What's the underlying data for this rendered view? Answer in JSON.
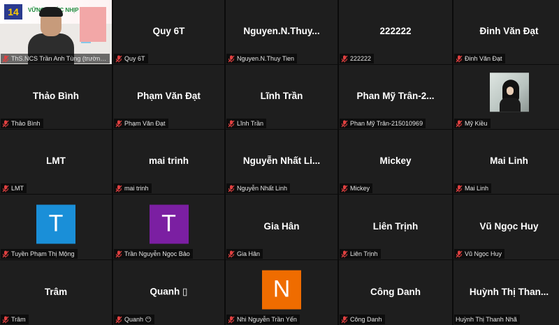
{
  "colors": {
    "tile_bg": "#1e1e1e",
    "speaker_border": "#c8e04a",
    "mute_icon": "#e04040",
    "avatar_t1": "#1a8fd8",
    "avatar_t2": "#7b1fa2",
    "avatar_n": "#ef6c00"
  },
  "speaker": {
    "logo_text": "14",
    "banner_text": "VỮNG BƯỚC NHỊP XA",
    "label": "ThS.NCS Trần Anh Tùng (trường n..."
  },
  "tiles": [
    {
      "name": "",
      "label": "ThS.NCS Trần Anh Tùng (trường n..."
    },
    {
      "name": "Quy 6T",
      "label": "Quy 6T"
    },
    {
      "name": "Nguyen.N.Thuy...",
      "label": "Nguyen.N.Thuy Tien"
    },
    {
      "name": "222222",
      "label": "222222"
    },
    {
      "name": "Đinh Văn Đạt",
      "label": "Đinh Văn Đạt"
    },
    {
      "name": "Thảo Bình",
      "label": "Thảo Bình"
    },
    {
      "name": "Phạm Văn Đạt",
      "label": "Phạm Văn Đạt"
    },
    {
      "name": "Lĩnh Trần",
      "label": "Lĩnh Trần"
    },
    {
      "name": "Phan Mỹ Trân-2...",
      "label": "Phan Mỹ Trân-215010969"
    },
    {
      "name": "",
      "label": "Mỹ Kiều"
    },
    {
      "name": "LMT",
      "label": "LMT"
    },
    {
      "name": "mai trinh",
      "label": "mai trinh"
    },
    {
      "name": "Nguyễn Nhất Li...",
      "label": "Nguyễn Nhất Linh"
    },
    {
      "name": "Mickey",
      "label": "Mickey"
    },
    {
      "name": "Mai Linh",
      "label": "Mai Linh"
    },
    {
      "name": "",
      "avatar_letter": "T",
      "label": "Tuyền Phạm Thị Mộng"
    },
    {
      "name": "",
      "avatar_letter": "T",
      "label": "Trần Nguyễn Ngọc Bảo"
    },
    {
      "name": "Gia Hân",
      "label": "Gia Hân"
    },
    {
      "name": "Liên Trịnh",
      "label": "Liên Trịnh"
    },
    {
      "name": "Vũ Ngọc Huy",
      "label": "Vũ Ngọc Huy"
    },
    {
      "name": "Trâm",
      "label": "Trâm"
    },
    {
      "name": "Quanh ▯",
      "label": "Quanh 😶"
    },
    {
      "name": "",
      "avatar_letter": "N",
      "label": "Nhi Nguyễn Trần Yến"
    },
    {
      "name": "Công Danh",
      "label": "Công Danh"
    },
    {
      "name": "Huỳnh Thị Than...",
      "label": "Huỳnh Thị Thanh Nhã"
    }
  ]
}
